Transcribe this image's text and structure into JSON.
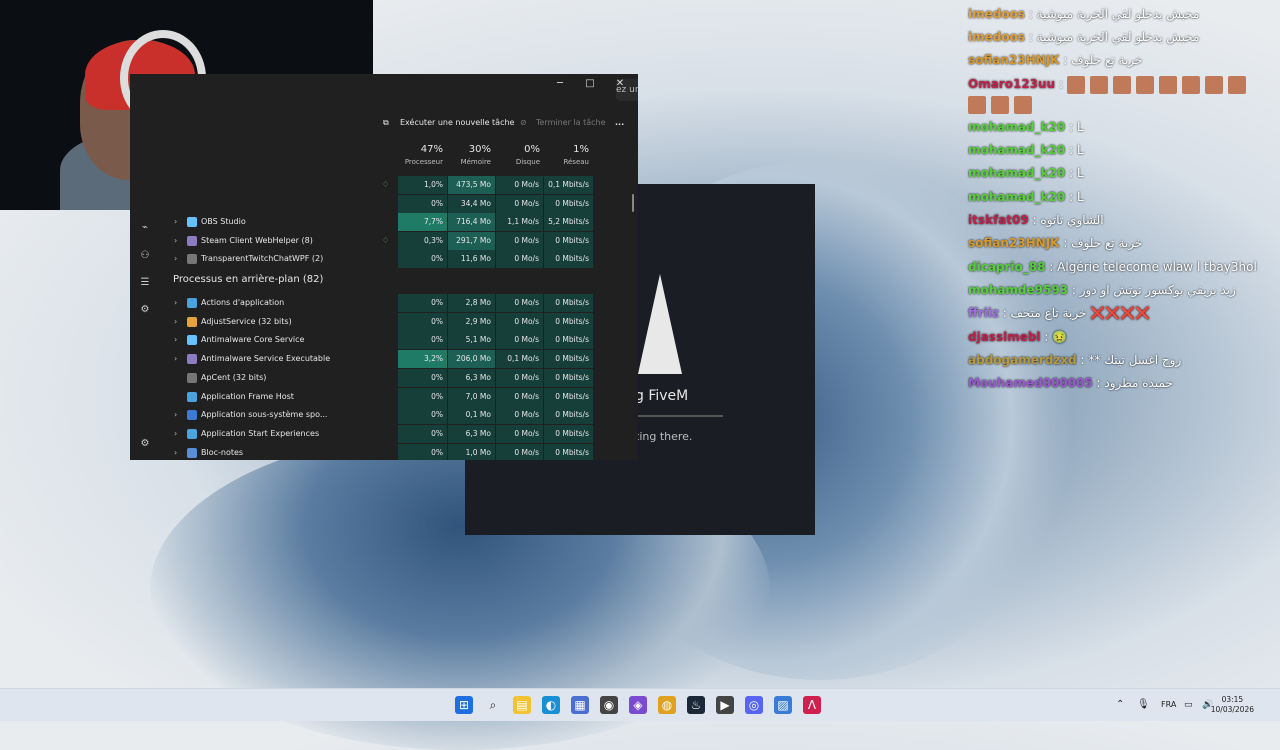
{
  "webcam": {
    "label": ""
  },
  "task_manager": {
    "search_placeholder": "ez un nom, un éditeu...",
    "toolbar": {
      "run_task": "Exécuter une nouvelle tâche",
      "end_task": "Terminer la tâche",
      "more": "..."
    },
    "columns": [
      {
        "pct": "47%",
        "label": "Processeur"
      },
      {
        "pct": "30%",
        "label": "Mémoire"
      },
      {
        "pct": "0%",
        "label": "Disque"
      },
      {
        "pct": "1%",
        "label": "Réseau"
      }
    ],
    "top_rows": [
      {
        "name": "",
        "cpu": "1,0%",
        "mem": "473,5 Mo",
        "disk": "0 Mo/s",
        "net": "0,1 Mbits/s",
        "leaf": true
      },
      {
        "name": "",
        "cpu": "0%",
        "mem": "34,4 Mo",
        "disk": "0 Mo/s",
        "net": "0 Mbits/s",
        "leaf": false
      },
      {
        "name": "OBS Studio",
        "cpu": "7,7%",
        "mem": "716,4 Mo",
        "disk": "1,1 Mo/s",
        "net": "5,2 Mbits/s",
        "leaf": false
      },
      {
        "name": "Steam Client WebHelper (8)",
        "cpu": "0,3%",
        "mem": "291,7 Mo",
        "disk": "0 Mo/s",
        "net": "0 Mbits/s",
        "leaf": true
      },
      {
        "name": "TransparentTwitchChatWPF (2)",
        "cpu": "0%",
        "mem": "11,6 Mo",
        "disk": "0 Mo/s",
        "net": "0 Mbits/s",
        "leaf": false
      }
    ],
    "section_title": "Processus en arrière-plan (82)",
    "bg_rows": [
      {
        "name": "Actions d'application",
        "cpu": "0%",
        "mem": "2,8 Mo",
        "disk": "0 Mo/s",
        "net": "0 Mbits/s"
      },
      {
        "name": "AdjustService (32 bits)",
        "cpu": "0%",
        "mem": "2,9 Mo",
        "disk": "0 Mo/s",
        "net": "0 Mbits/s"
      },
      {
        "name": "Antimalware Core Service",
        "cpu": "0%",
        "mem": "5,1 Mo",
        "disk": "0 Mo/s",
        "net": "0 Mbits/s"
      },
      {
        "name": "Antimalware Service Executable",
        "cpu": "3,2%",
        "mem": "206,0 Mo",
        "disk": "0,1 Mo/s",
        "net": "0 Mbits/s"
      },
      {
        "name": "ApCent (32 bits)",
        "cpu": "0%",
        "mem": "6,3 Mo",
        "disk": "0 Mo/s",
        "net": "0 Mbits/s"
      },
      {
        "name": "Application Frame Host",
        "cpu": "0%",
        "mem": "7,0 Mo",
        "disk": "0 Mo/s",
        "net": "0 Mbits/s"
      },
      {
        "name": "Application sous-système spo...",
        "cpu": "0%",
        "mem": "0,1 Mo",
        "disk": "0 Mo/s",
        "net": "0 Mbits/s"
      },
      {
        "name": "Application Start Experiences",
        "cpu": "0%",
        "mem": "6,3 Mo",
        "disk": "0 Mo/s",
        "net": "0 Mbits/s"
      },
      {
        "name": "Bloc-notes",
        "cpu": "0%",
        "mem": "1,0 Mo",
        "disk": "0 Mo/s",
        "net": "0 Mbits/s"
      }
    ]
  },
  "fivem": {
    "title": "g FiveM",
    "subtitle": "ting there."
  },
  "chat": [
    {
      "user": "imedoos",
      "color": "#e0a13c",
      "text": ": محبش يدخلو لقي الخربة ميوشية",
      "emotes": 0
    },
    {
      "user": "imedoos",
      "color": "#e0a13c",
      "text": ": محبش يدخلو لقي الخربة ميوشية",
      "emotes": 0
    },
    {
      "user": "sofian23HNJK",
      "color": "#d99a2b",
      "text": ": خربة تع حلوف",
      "emotes": 0
    },
    {
      "user": "Omaro123uu",
      "color": "#c0204a",
      "text": ":",
      "emotes": 8
    },
    {
      "user": "",
      "color": "#c0204a",
      "text": "",
      "emotes": 3
    },
    {
      "user": "mohamad_k20",
      "color": "#56d13a",
      "text": ": L",
      "emotes": 0
    },
    {
      "user": "mohamad_k20",
      "color": "#56d13a",
      "text": ": L",
      "emotes": 0
    },
    {
      "user": "mohamad_k20",
      "color": "#56d13a",
      "text": ": L",
      "emotes": 0
    },
    {
      "user": "mohamad_k20",
      "color": "#56d13a",
      "text": ": L",
      "emotes": 0
    },
    {
      "user": "itskfat09",
      "color": "#c0204a",
      "text": ": الشاوي تاتوه",
      "emotes": 0
    },
    {
      "user": "sofian23HNJK",
      "color": "#d99a2b",
      "text": ": خربة تع حلوف",
      "emotes": 0
    },
    {
      "user": "dicaprio_88",
      "color": "#56d13a",
      "text": ": Algérie telecome wlaw l tbay3hol",
      "emotes": 0
    },
    {
      "user": "mohamde9593",
      "color": "#56d13a",
      "text": ": زيد بريفي بوكسور توتش او دور",
      "emotes": 0
    },
    {
      "user": "ffriiz",
      "color": "#a070e0",
      "text": ": خربة تاع متحف ❌❌❌❌",
      "emotes": 0
    },
    {
      "user": "djasslmebl",
      "color": "#c0204a",
      "text": ": 🤢",
      "emotes": 0
    },
    {
      "user": "abdogamerdzxd",
      "color": "#b79a3d",
      "text": ": ** روح اغسل تيتك",
      "emotes": 0
    },
    {
      "user": "Mouhamed000005",
      "color": "#9b59d0",
      "text": ": حميدة مطرود",
      "emotes": 0
    }
  ],
  "taskbar": {
    "lang": "FRA",
    "time": "03:15",
    "date": "10/03/2026",
    "icons": [
      "windows-start-icon",
      "search-icon",
      "file-explorer-icon",
      "edge-icon",
      "store-icon",
      "obs-icon",
      "twitch-icon",
      "chrome-icon",
      "steam-icon",
      "media-player-icon",
      "discord-icon",
      "photos-icon",
      "fivem-icon"
    ]
  }
}
